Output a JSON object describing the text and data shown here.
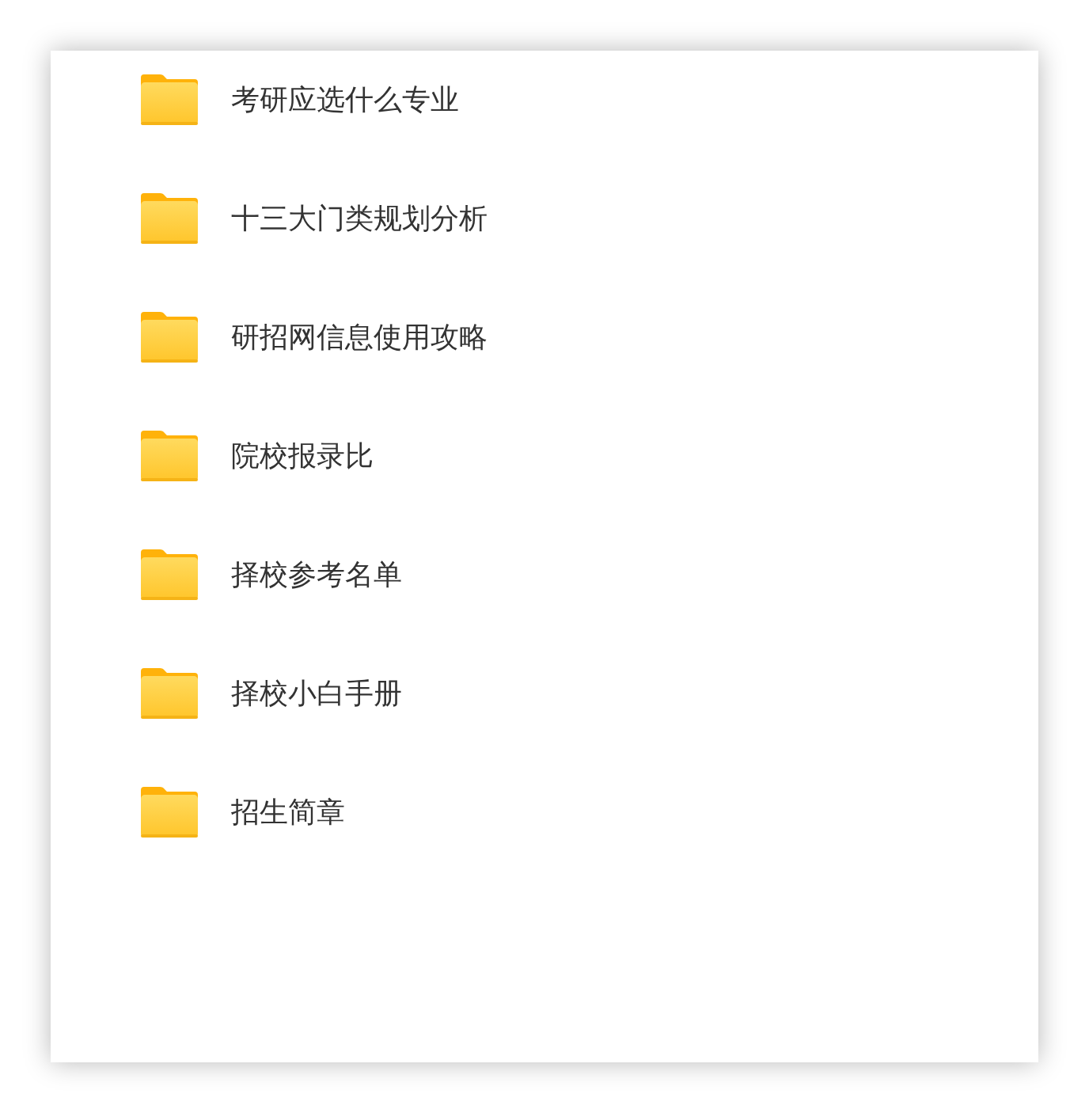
{
  "folders": [
    {
      "name": "考研应选什么专业"
    },
    {
      "name": "十三大门类规划分析"
    },
    {
      "name": "研招网信息使用攻略"
    },
    {
      "name": "院校报录比"
    },
    {
      "name": "择校参考名单"
    },
    {
      "name": "择校小白手册"
    },
    {
      "name": "招生简章"
    }
  ]
}
